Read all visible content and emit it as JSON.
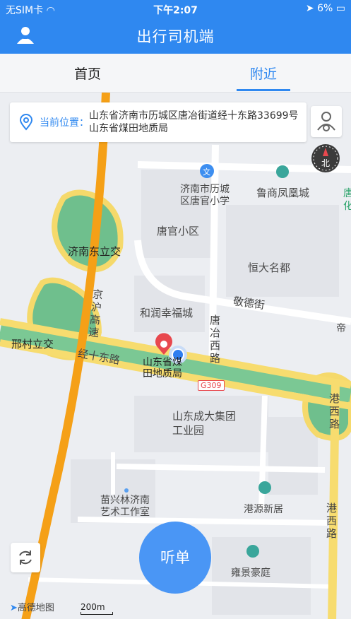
{
  "status_bar": {
    "carrier": "无SIM卡",
    "time": "下午2:07",
    "battery": "6%"
  },
  "header": {
    "title": "出行司机端"
  },
  "tabs": [
    {
      "label": "首页"
    },
    {
      "label": "附近"
    }
  ],
  "location": {
    "label": "当前位置：",
    "address": "山东省济南市历城区唐冶街道经十东路33699号山东省煤田地质局"
  },
  "map": {
    "labels": {
      "school": "济南市历城区唐官小学",
      "mall": "鲁商凤凰城",
      "tangguan": "唐官小区",
      "jinan_east": "济南东立交",
      "hengda": "恒大名都",
      "jingde": "敬德街",
      "hurun": "和润幸福城",
      "jinghu": "京沪高速",
      "tangye": "唐冶西路",
      "xingcun": "邢村立交",
      "jingshi": "经十东路",
      "geology": "山东省煤田地质局",
      "g309": "G309",
      "chengda": "山东成大集团工业园",
      "gangxi1": "港西路",
      "gangxi2": "港西路",
      "miaoxinglin": "苗兴林济南艺术工作室",
      "gangyuan": "港源新居",
      "yongjing": "雍景豪庭",
      "tang_right": "唐化",
      "di_right": "帝"
    },
    "scale": "200m",
    "brand": "高德地图"
  },
  "actions": {
    "listen": "听单"
  }
}
